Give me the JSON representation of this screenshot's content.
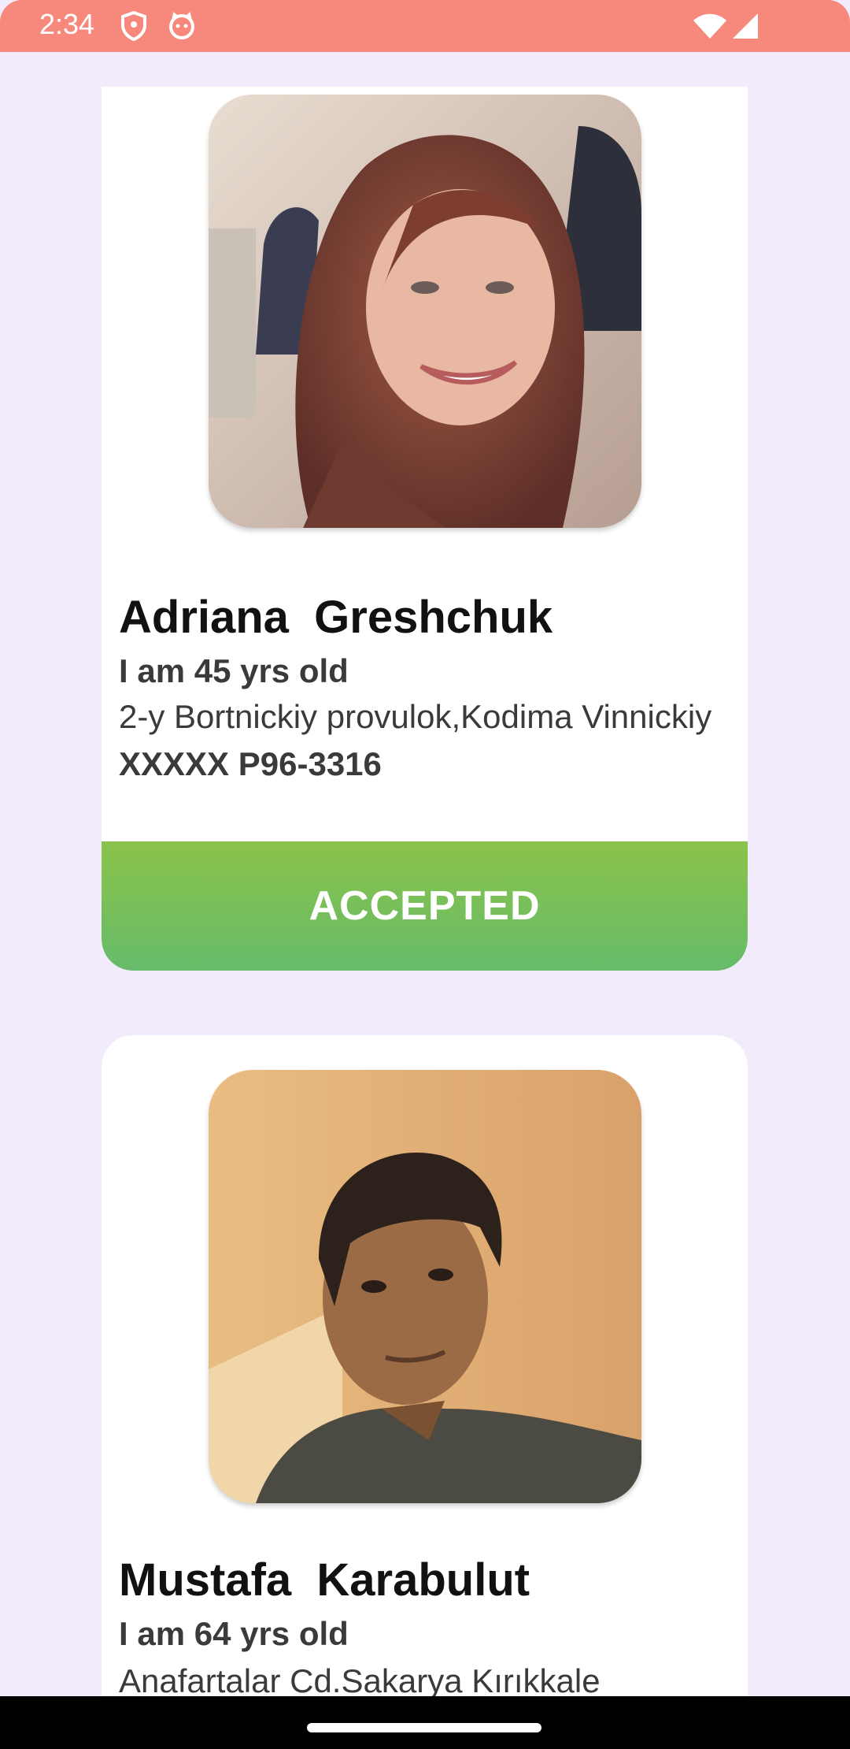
{
  "status_bar": {
    "time": "2:34",
    "icons": [
      "shield-icon",
      "cat-icon",
      "wifi-icon",
      "signal-icon"
    ],
    "color": "#f7897c"
  },
  "cards": [
    {
      "name": "Adriana  Greshchuk",
      "age_text": "I am 45 yrs old",
      "address": "2-y Bortnickiy provulok,Kodima Vinnickiy",
      "phone": "XXXXX P96-3316",
      "status_button": "ACCEPTED",
      "photo": "woman-portrait"
    },
    {
      "name": "Mustafa  Karabulut",
      "age_text": "I am 64 yrs old",
      "address": "Anafartalar Cd.Sakarya Kırıkkale",
      "photo": "man-portrait"
    }
  ],
  "colors": {
    "background": "#f1ebfc",
    "accepted_top": "#8bc34a",
    "accepted_bottom": "#66bb6a"
  }
}
